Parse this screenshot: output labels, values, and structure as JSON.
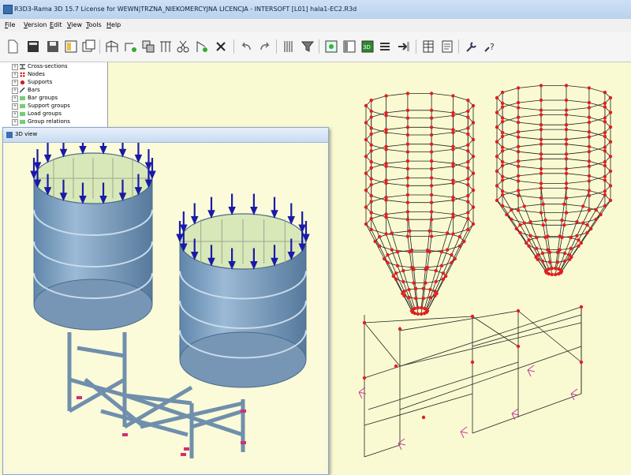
{
  "window": {
    "title": "R3D3-Rama 3D 15.7 License for WEWN|TRZNA_NIEKOMERCYJNA LICENCJA - INTERSOFT [L01] hala1-EC2.R3d"
  },
  "menu": [
    "File",
    "Version",
    "Edit",
    "View",
    "Tools",
    "Help"
  ],
  "toolbar": [
    "new-icon",
    "open-icon",
    "save-icon",
    "preview-icon",
    "copy-window-icon",
    "frame-icon",
    "add-node-icon",
    "copy-icon",
    "grid-icon",
    "cut-icon",
    "node-edit-icon",
    "delete-icon",
    "undo-icon",
    "redo-icon",
    "columns-icon",
    "filter-icon",
    "layers-icon",
    "view-panel-icon",
    "3d-view-icon",
    "bars-icon",
    "import-icon",
    "table-icon",
    "report-icon",
    "settings-icon",
    "help-icon"
  ],
  "tree": [
    {
      "label": "Cross-sections",
      "icon": "cross-sections-icon"
    },
    {
      "label": "Nodes",
      "icon": "nodes-icon"
    },
    {
      "label": "Supports",
      "icon": "supports-icon"
    },
    {
      "label": "Bars",
      "icon": "bars-icon"
    },
    {
      "label": "Bar groups",
      "icon": "bar-groups-icon"
    },
    {
      "label": "Support groups",
      "icon": "support-groups-icon"
    },
    {
      "label": "Load groups",
      "icon": "load-groups-icon"
    },
    {
      "label": "Group relations",
      "icon": "group-relations-icon"
    }
  ],
  "view3d": {
    "title": "3D view"
  },
  "colors": {
    "node": "#e02020",
    "load_arrow": "#1a1aa8",
    "tank": "#7a9fbf",
    "support": "#d03070",
    "background": "#fafad2"
  }
}
